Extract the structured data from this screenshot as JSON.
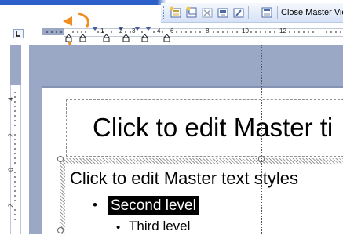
{
  "toolbar": {
    "close_master_view_label": "Close Master Vie",
    "buttons": [
      "insert-new-slide-master-icon",
      "insert-new-title-master-icon",
      "delete-master-icon",
      "preserve-master-icon",
      "rename-master-icon",
      "master-layout-icon"
    ]
  },
  "rulers": {
    "horizontal_numbers": [
      "1",
      "2",
      "3",
      "4",
      "6",
      "8",
      "10",
      "12"
    ],
    "vertical_numbers": [
      "4",
      "2",
      "0",
      "2"
    ]
  },
  "slide": {
    "title_text": "Click to edit Master ti",
    "body_level1": "Click to edit Master text styles",
    "body_level2": "Second level",
    "body_level3": "Third level",
    "bullet_char": "•"
  },
  "colors": {
    "canvas_background": "#9aa8c6",
    "arrow_accent": "#f28c1c",
    "selection_highlight": "#000000"
  }
}
